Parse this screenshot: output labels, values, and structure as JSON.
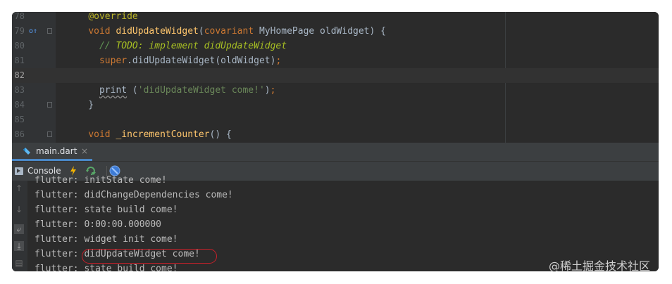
{
  "editor": {
    "lines": [
      {
        "num": "78",
        "segments": [
          {
            "t": "    "
          },
          {
            "t": "@override",
            "c": "ann"
          }
        ]
      },
      {
        "num": "79",
        "segments": [
          {
            "t": "    "
          },
          {
            "t": "void ",
            "c": "kw"
          },
          {
            "t": "didUpdateWidget",
            "c": "fn"
          },
          {
            "t": "("
          },
          {
            "t": "covariant ",
            "c": "kw"
          },
          {
            "t": "MyHomePage oldWidget) {"
          }
        ]
      },
      {
        "num": "80",
        "segments": [
          {
            "t": "      "
          },
          {
            "t": "// ",
            "c": "cmt"
          },
          {
            "t": "TODO: implement didUpdateWidget",
            "c": "todo"
          }
        ]
      },
      {
        "num": "81",
        "segments": [
          {
            "t": "      "
          },
          {
            "t": "super",
            "c": "kw"
          },
          {
            "t": ".didUpdateWidget(oldWidget)"
          },
          {
            "t": ";",
            "c": "kw"
          }
        ]
      },
      {
        "num": "82",
        "segments": [
          {
            "t": ""
          }
        ]
      },
      {
        "num": "83",
        "segments": [
          {
            "t": "      "
          },
          {
            "t": "print",
            "c": "squig"
          },
          {
            "t": " ("
          },
          {
            "t": "'didUpdateWidget come!'",
            "c": "str"
          },
          {
            "t": ")"
          },
          {
            "t": ";",
            "c": "kw"
          }
        ]
      },
      {
        "num": "84",
        "segments": [
          {
            "t": "    }"
          }
        ]
      },
      {
        "num": "85",
        "segments": [
          {
            "t": ""
          }
        ]
      },
      {
        "num": "86",
        "segments": [
          {
            "t": "    "
          },
          {
            "t": "void ",
            "c": "kw"
          },
          {
            "t": "_incrementCounter",
            "c": "fn"
          },
          {
            "t": "() {"
          }
        ]
      }
    ],
    "override_marker": "o↑"
  },
  "tab": {
    "label": "main.dart",
    "close": "×"
  },
  "toolbar": {
    "console_label": "Console"
  },
  "console": {
    "lines": [
      "flutter: initState come!",
      "flutter: didChangeDependencies come!",
      "flutter: state build come!",
      "flutter: 0:00:00.000000",
      "flutter: widget init come!",
      "flutter: didUpdateWidget come!",
      "flutter: state build come!"
    ]
  },
  "watermark": "@稀土掘金技术社区"
}
